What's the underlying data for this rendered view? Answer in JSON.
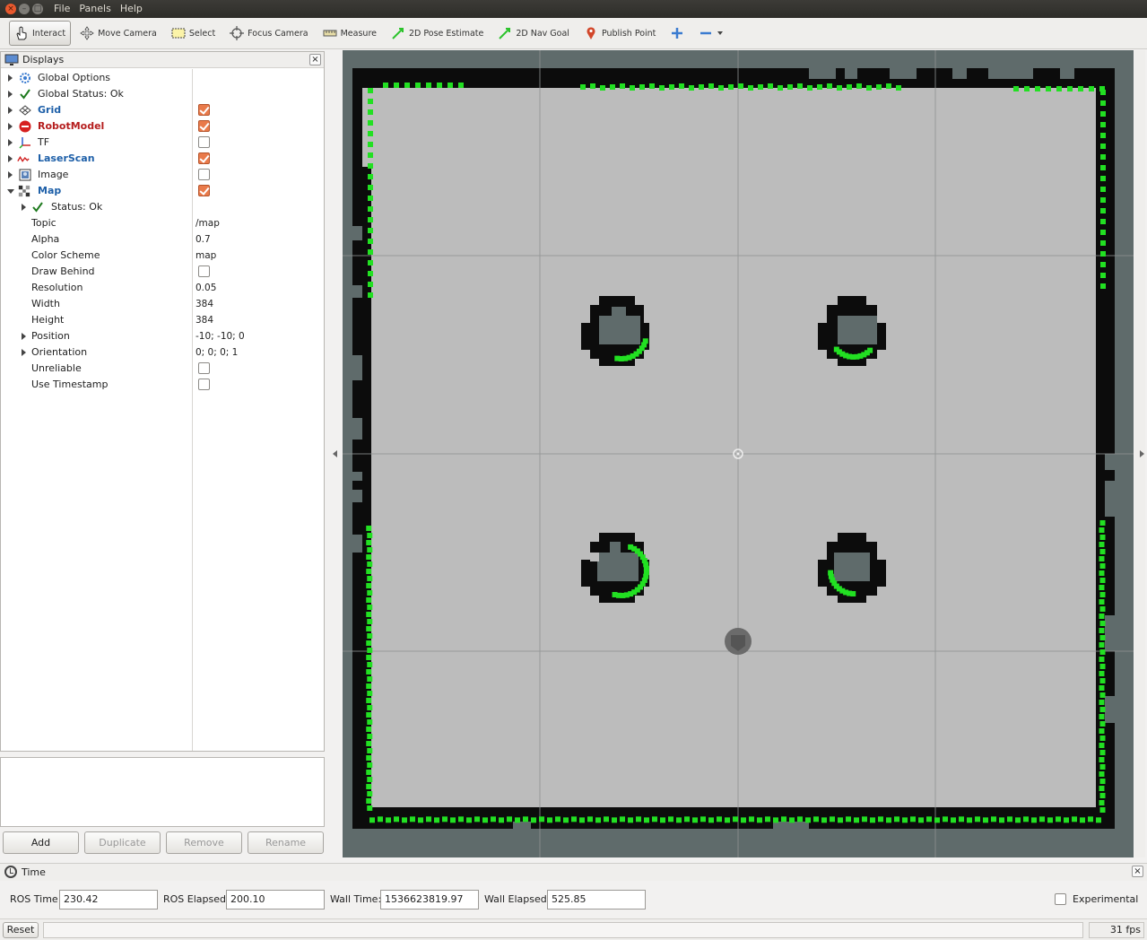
{
  "menu": {
    "file": "File",
    "panels": "Panels",
    "help": "Help"
  },
  "toolbar": {
    "interact": "Interact",
    "move_camera": "Move Camera",
    "select": "Select",
    "focus_camera": "Focus Camera",
    "measure": "Measure",
    "pose_estimate": "2D Pose Estimate",
    "nav_goal": "2D Nav Goal",
    "publish_point": "Publish Point"
  },
  "displays": {
    "title": "Displays",
    "items": [
      {
        "label": "Global Options"
      },
      {
        "label": "Global Status: Ok"
      },
      {
        "label": "Grid"
      },
      {
        "label": "RobotModel"
      },
      {
        "label": "TF"
      },
      {
        "label": "LaserScan"
      },
      {
        "label": "Image"
      },
      {
        "label": "Map"
      }
    ],
    "map_props": {
      "status": "Status: Ok",
      "topic_label": "Topic",
      "topic": "/map",
      "alpha_label": "Alpha",
      "alpha": "0.7",
      "scheme_label": "Color Scheme",
      "scheme": "map",
      "draw_behind_label": "Draw Behind",
      "resolution_label": "Resolution",
      "resolution": "0.05",
      "width_label": "Width",
      "width": "384",
      "height_label": "Height",
      "height": "384",
      "position_label": "Position",
      "position": "-10; -10; 0",
      "orientation_label": "Orientation",
      "orientation": "0; 0; 0; 1",
      "unreliable_label": "Unreliable",
      "timestamp_label": "Use Timestamp"
    }
  },
  "buttons": {
    "add": "Add",
    "duplicate": "Duplicate",
    "remove": "Remove",
    "rename": "Rename"
  },
  "time": {
    "title": "Time",
    "ros_time_label": "ROS Time:",
    "ros_time": "230.42",
    "ros_elapsed_label": "ROS Elapsed:",
    "ros_elapsed": "200.10",
    "wall_time_label": "Wall Time:",
    "wall_time": "1536623819.97",
    "wall_elapsed_label": "Wall Elapsed:",
    "wall_elapsed": "525.85",
    "experimental_label": "Experimental"
  },
  "status": {
    "reset": "Reset",
    "fps": "31 fps"
  },
  "colors": {
    "laser": "#22e022",
    "map_free": "#bcbcbc",
    "map_wall": "#0c0c0c",
    "map_unknown": "#5f6b6b"
  }
}
